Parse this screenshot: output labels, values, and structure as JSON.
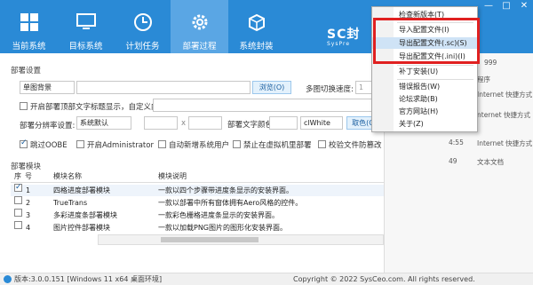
{
  "tabs": [
    {
      "label": "当前系统",
      "icon": "windows-icon"
    },
    {
      "label": "目标系统",
      "icon": "monitor-icon"
    },
    {
      "label": "计划任务",
      "icon": "clock-icon"
    },
    {
      "label": "部署过程",
      "icon": "gear-icon"
    },
    {
      "label": "系统封装",
      "icon": "package-icon"
    }
  ],
  "logo": {
    "main": "SC封",
    "sub": "SysPre"
  },
  "colors": {
    "header": "#2a8ad6",
    "active_tab": "#5aa6e4",
    "highlight_border": "#e02020"
  },
  "deploy": {
    "section_title": "部署设置",
    "bg_select": "单图背景",
    "browse_label": "浏览(O)",
    "multi_switch_label": "多图切换速度:",
    "multi_switch_value": "1",
    "top_text_check": "开启部署顶部文字标题显示，自定义内容:",
    "resolution_label": "部署分辨率设置:",
    "resolution_value": "系统默认",
    "times": "x",
    "text_color_label": "部署文字颜色:",
    "text_color_value": "clWhite",
    "color_btn": "取色(C)",
    "options": [
      {
        "label": "跳过OOBE",
        "checked": true
      },
      {
        "label": "开启Administrator",
        "checked": false
      },
      {
        "label": "自动新增系统用户",
        "checked": false
      },
      {
        "label": "禁止在虚拟机里部署",
        "checked": false
      },
      {
        "label": "校验文件防篡改",
        "checked": false
      }
    ]
  },
  "modules": {
    "section_title": "部署模块",
    "headers": [
      "序",
      "号",
      "模块名称",
      "模块说明"
    ],
    "rows": [
      {
        "no": "1",
        "name": "四格进度部署模块",
        "desc": "一款以四个步骤带进度条显示的安装界面。",
        "checked": true
      },
      {
        "no": "2",
        "name": "TrueTrans",
        "desc": "一款以部署中所有窗体拥有Aero风格的控件。",
        "checked": false
      },
      {
        "no": "3",
        "name": "多彩进度条部署模块",
        "desc": "一款彩色栅格进度条显示的安装界面。",
        "checked": false
      },
      {
        "no": "4",
        "name": "图片控件部署模块",
        "desc": "一款以加载PNG图片的图形化安装界面。",
        "checked": false
      }
    ]
  },
  "right_panel": [
    {
      "text": "999"
    },
    {
      "text": "程序"
    },
    {
      "text": "Internet 快捷方式"
    },
    {
      "text": "nternet 快捷方式"
    },
    {
      "text": "4:55"
    },
    {
      "text": "Internet 快捷方式"
    },
    {
      "text": "49"
    },
    {
      "text": "文本文档"
    }
  ],
  "menu": {
    "items": [
      {
        "label": "检查新版本(T)"
      },
      {
        "label": "导入配置文件(I)"
      },
      {
        "label": "导出配置文件(.sc)(S)",
        "highlighted": true
      },
      {
        "label": "导出配置文件(.ini)(I)"
      },
      {
        "label": "补丁安装(U)"
      },
      {
        "label": "错误报告(W)"
      },
      {
        "label": "论坛求助(B)"
      },
      {
        "label": "官方网站(H)"
      },
      {
        "label": "关于(Z)"
      }
    ]
  },
  "status": {
    "version": "版本:3.0.0.151 [Windows 11 x64 桌面环境]",
    "copyright": "Copyright © 2022 SysCeo.com. All rights reserved."
  }
}
